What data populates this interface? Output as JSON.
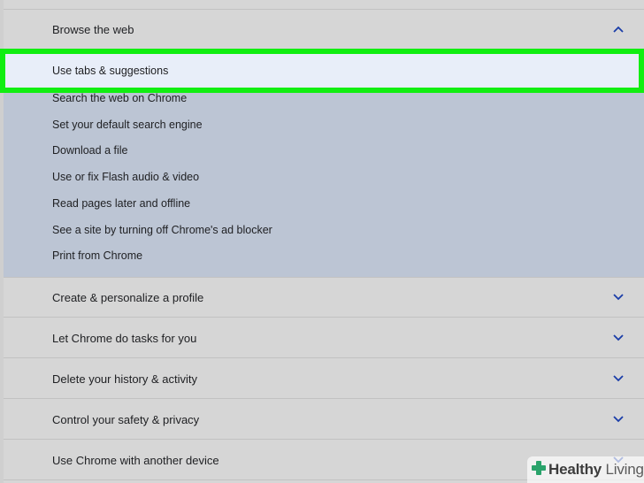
{
  "sections": {
    "browse": {
      "title": "Browse the web",
      "items": [
        "Use tabs & suggestions",
        "Search the web on Chrome",
        "Set your default search engine",
        "Download a file",
        "Use or fix Flash audio & video",
        "Read pages later and offline",
        "See a site by turning off Chrome's ad blocker",
        "Print from Chrome"
      ]
    },
    "profile": {
      "title": "Create & personalize a profile"
    },
    "tasks": {
      "title": "Let Chrome do tasks for you"
    },
    "history": {
      "title": "Delete your history & activity"
    },
    "safety": {
      "title": "Control your safety & privacy"
    },
    "device": {
      "title": "Use Chrome with another device"
    }
  },
  "watermark": {
    "brand": "Healthy",
    "suffix": "Living"
  },
  "colors": {
    "highlight_border": "#11ee11",
    "chevron": "#1a3da8",
    "expanded_bg": "#bcc5d4"
  }
}
